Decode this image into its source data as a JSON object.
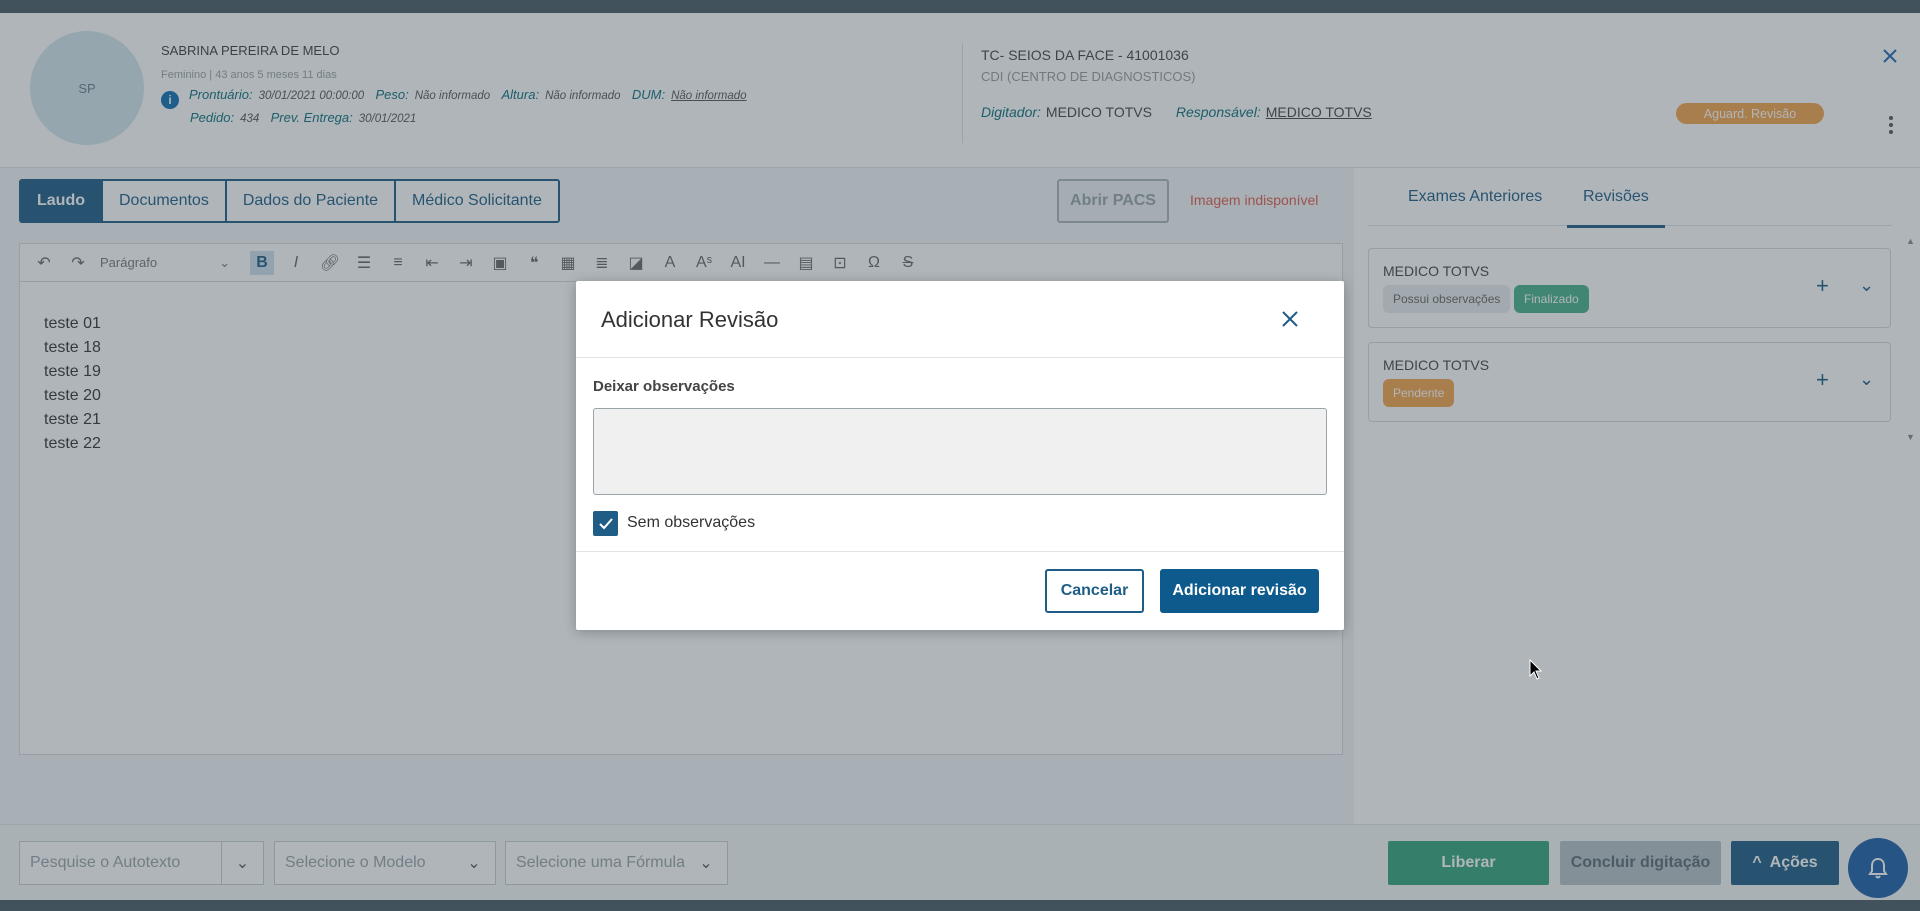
{
  "patient": {
    "initials": "SP",
    "name": "SABRINA PEREIRA DE MELO",
    "subline": "Feminino | 43 anos 5 meses 11 dias",
    "prontuario_label": "Prontuário:",
    "prontuario_value": "30/01/2021 00:00:00",
    "peso_label": "Peso:",
    "peso_value": "Não informado",
    "altura_label": "Altura:",
    "altura_value": "Não informado",
    "dum_label": "DUM:",
    "dum_value": "Não informado",
    "pedido_label": "Pedido:",
    "pedido_value": "434",
    "prev_label": "Prev. Entrega:",
    "prev_value": "30/01/2021"
  },
  "exam": {
    "title": "TC- SEIOS DA FACE - 41001036",
    "center": "CDI (CENTRO DE DIAGNOSTICOS)",
    "digitador_label": "Digitador:",
    "digitador_value": "MEDICO TOTVS",
    "responsavel_label": "Responsável:",
    "responsavel_value": "MEDICO TOTVS",
    "status": "Aguard. Revisão",
    "status_color": "#f6a44c"
  },
  "tabs": [
    {
      "label": "Laudo"
    },
    {
      "label": "Documentos"
    },
    {
      "label": "Dados do Paciente"
    },
    {
      "label": "Médico Solicitante"
    }
  ],
  "actions": {
    "abrir_pacs": "Abrir PACS",
    "imagem_status": "Imagem indisponível"
  },
  "editor": {
    "paragraph_select": "Parágrafo",
    "lines": [
      "teste 01",
      "teste 18",
      "teste 19",
      "teste 20",
      "teste 21",
      "teste 22"
    ]
  },
  "right_panel": {
    "tabs": [
      {
        "label": "Exames Anteriores"
      },
      {
        "label": "Revisões"
      }
    ],
    "reviews": [
      {
        "name": "MEDICO TOTVS",
        "chips": [
          "Possui observações",
          "Finalizado"
        ]
      },
      {
        "name": "MEDICO TOTVS",
        "chips": [
          "Pendente"
        ]
      }
    ]
  },
  "footer": {
    "autotexto_placeholder": "Pesquise o Autotexto",
    "modelo_placeholder": "Selecione o Modelo",
    "formula_placeholder": "Selecione uma Fórmula",
    "liberar": "Liberar",
    "concluir": "Concluir digitação",
    "acoes": "Ações"
  },
  "modal": {
    "title": "Adicionar Revisão",
    "obs_label": "Deixar observações",
    "obs_value": "",
    "checkbox_label": "Sem observações",
    "checkbox_checked": true,
    "cancel": "Cancelar",
    "confirm": "Adicionar revisão"
  },
  "colors": {
    "primary": "#1f5d86",
    "success": "#35a37b",
    "warning": "#f6a44c",
    "danger": "#e05a4e"
  }
}
